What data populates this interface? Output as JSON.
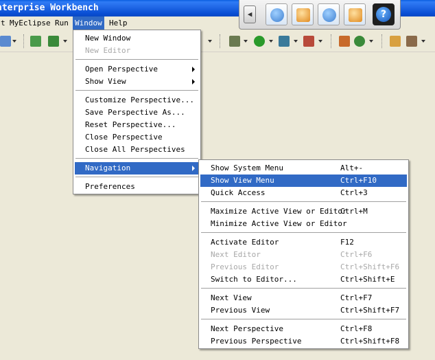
{
  "window": {
    "title": "nterprise Workbench"
  },
  "menubar": {
    "items": [
      {
        "label": "t"
      },
      {
        "label": "MyEclipse"
      },
      {
        "label": "Run"
      },
      {
        "label": "Window"
      },
      {
        "label": "Help"
      }
    ]
  },
  "window_menu": {
    "items": [
      {
        "label": "New Window"
      },
      {
        "label": "New Editor"
      },
      {
        "label": "Open Perspective"
      },
      {
        "label": "Show View"
      },
      {
        "label": "Customize Perspective..."
      },
      {
        "label": "Save Perspective As..."
      },
      {
        "label": "Reset Perspective..."
      },
      {
        "label": "Close Perspective"
      },
      {
        "label": "Close All Perspectives"
      },
      {
        "label": "Navigation"
      },
      {
        "label": "Preferences"
      }
    ]
  },
  "navigation_menu": {
    "items": [
      {
        "label": "Show System Menu",
        "shortcut": "Alt+-"
      },
      {
        "label": "Show View Menu",
        "shortcut": "Ctrl+F10"
      },
      {
        "label": "Quick Access",
        "shortcut": "Ctrl+3"
      },
      {
        "label": "Maximize Active View or Editor",
        "shortcut": "Ctrl+M"
      },
      {
        "label": "Minimize Active View or Editor",
        "shortcut": ""
      },
      {
        "label": "Activate Editor",
        "shortcut": "F12"
      },
      {
        "label": "Next Editor",
        "shortcut": "Ctrl+F6"
      },
      {
        "label": "Previous Editor",
        "shortcut": "Ctrl+Shift+F6"
      },
      {
        "label": "Switch to Editor...",
        "shortcut": "Ctrl+Shift+E"
      },
      {
        "label": "Next View",
        "shortcut": "Ctrl+F7"
      },
      {
        "label": "Previous View",
        "shortcut": "Ctrl+Shift+F7"
      },
      {
        "label": "Next Perspective",
        "shortcut": "Ctrl+F8"
      },
      {
        "label": "Previous Perspective",
        "shortcut": "Ctrl+Shift+F8"
      }
    ]
  },
  "floating_toolbar": {
    "help_label": "?",
    "icons": [
      "back-arrow-icon",
      "perspective-check-icon",
      "hand-icon",
      "user-icon",
      "export-icon",
      "help-icon"
    ]
  },
  "colors": {
    "titlebar": "#0a4fd4",
    "highlight": "#316ac5",
    "menu_bg": "#ffffff",
    "chrome": "#ece9d8",
    "disabled_text": "#a8a8a8"
  }
}
